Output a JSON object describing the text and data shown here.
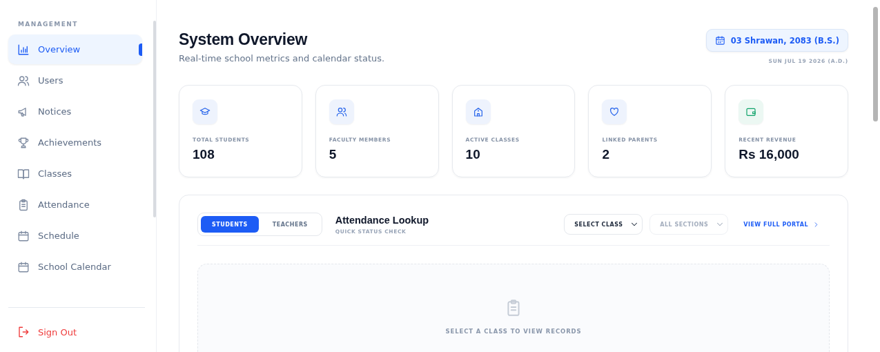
{
  "sidebar": {
    "heading": "MANAGEMENT",
    "items": [
      {
        "label": "Overview",
        "selected": true
      },
      {
        "label": "Users",
        "selected": false
      },
      {
        "label": "Notices",
        "selected": false
      },
      {
        "label": "Achievements",
        "selected": false
      },
      {
        "label": "Classes",
        "selected": false
      },
      {
        "label": "Attendance",
        "selected": false
      },
      {
        "label": "Schedule",
        "selected": false
      },
      {
        "label": "School Calendar",
        "selected": false
      }
    ],
    "sign_out": "Sign Out"
  },
  "header": {
    "title": "System Overview",
    "subtitle": "Real-time school metrics and calendar status.",
    "date_bs": "03 Shrawan, 2083 (B.S.)",
    "date_ad": "SUN JUL 19 2026 (A.D.)"
  },
  "stats": [
    {
      "label": "TOTAL STUDENTS",
      "value": "108",
      "color": "#2563eb"
    },
    {
      "label": "FACULTY MEMBERS",
      "value": "5",
      "color": "#2563eb"
    },
    {
      "label": "ACTIVE CLASSES",
      "value": "10",
      "color": "#2563eb"
    },
    {
      "label": "LINKED PARENTS",
      "value": "2",
      "color": "#2563eb"
    },
    {
      "label": "RECENT REVENUE",
      "value": "Rs 16,000",
      "color": "#10a36b"
    }
  ],
  "attendance": {
    "tabs": [
      {
        "label": "STUDENTS",
        "selected": true
      },
      {
        "label": "TEACHERS",
        "selected": false
      }
    ],
    "title": "Attendance Lookup",
    "subtitle": "QUICK STATUS CHECK",
    "selects": [
      {
        "label": "SELECT CLASS",
        "disabled": false
      },
      {
        "label": "ALL SECTIONS",
        "disabled": true
      }
    ],
    "link": "VIEW FULL PORTAL",
    "empty_message": "SELECT A CLASS TO VIEW RECORDS"
  }
}
